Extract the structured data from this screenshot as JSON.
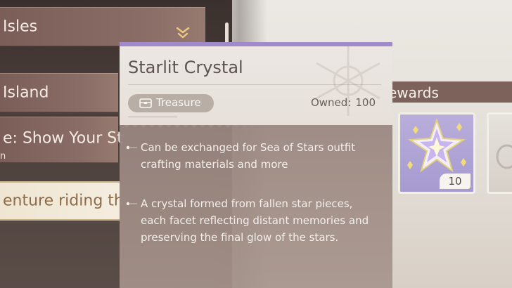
{
  "quest_list": {
    "items": [
      {
        "label": "Isles"
      },
      {
        "label": "Island"
      },
      {
        "label": "e: Show Your St",
        "sub": "n"
      },
      {
        "label": "enture riding th"
      }
    ]
  },
  "rewards": {
    "label": "ewards",
    "items": [
      {
        "icon": "starlit-crystal-icon",
        "quantity": "10"
      }
    ]
  },
  "tooltip": {
    "title": "Starlit Crystal",
    "type_label": "Treasure",
    "owned_label": "Owned:",
    "owned_value": "100",
    "descriptions": [
      "Can be exchanged for Sea of Stars outfit crafting materials and more",
      "A crystal formed from fallen star pieces, each facet reflecting distant memories and preserving the final glow of the stars."
    ],
    "colors": {
      "accent": "#a08acb",
      "header_bg": "#ece7e3",
      "body_bg": "#9a8680",
      "pill_bg": "#b9aea6"
    }
  }
}
